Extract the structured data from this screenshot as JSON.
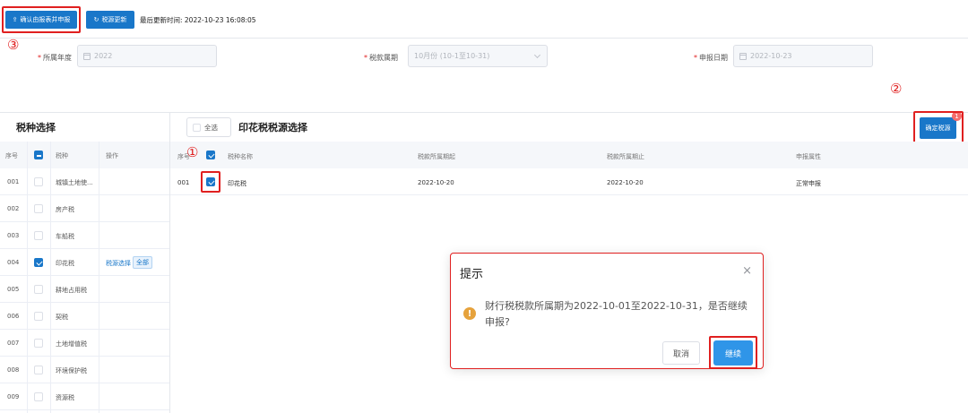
{
  "toolbar": {
    "confirm_label": "确认由报表并申报",
    "refresh_label": "税源更新",
    "last_update_label": "最后更新时间: 2022-10-23 16:08:05"
  },
  "annotations": {
    "step1": "①",
    "step2": "②",
    "step3": "③"
  },
  "form": {
    "year_label": "所属年度",
    "year_value": "2022",
    "period_label": "税款属期",
    "period_value": "10月份 (10-1至10-31)",
    "date_label": "申报日期",
    "date_value": "2022-10-23"
  },
  "left_panel": {
    "title": "税种选择",
    "headers": {
      "no": "序号",
      "name": "税种",
      "op": "操作"
    },
    "rows": [
      {
        "no": "001",
        "name": "城镇土地使...",
        "checked": false
      },
      {
        "no": "002",
        "name": "房产税",
        "checked": false
      },
      {
        "no": "003",
        "name": "车船税",
        "checked": false
      },
      {
        "no": "004",
        "name": "印花税",
        "checked": true,
        "op_link": "税源选择",
        "op_tag": "全部"
      },
      {
        "no": "005",
        "name": "耕地占用税",
        "checked": false
      },
      {
        "no": "006",
        "name": "契税",
        "checked": false
      },
      {
        "no": "007",
        "name": "土地增值税",
        "checked": false
      },
      {
        "no": "008",
        "name": "环境保护税",
        "checked": false
      },
      {
        "no": "009",
        "name": "资源税",
        "checked": false
      }
    ]
  },
  "right_panel": {
    "select_all_label": "全选",
    "title": "印花税税源选择",
    "confirm_button": "确定税源",
    "badge_count": "1",
    "headers": {
      "no": "序号",
      "name": "税种名称",
      "start": "税款所属期起",
      "end": "税款所属期止",
      "attr": "申报属性"
    },
    "rows": [
      {
        "no": "001",
        "checked": true,
        "name": "印花税",
        "start": "2022-10-20",
        "end": "2022-10-20",
        "attr": "正常申报"
      }
    ]
  },
  "dialog": {
    "title": "提示",
    "close": "×",
    "message": "财行税税款所属期为2022-10-01至2022-10-31，是否继续申报?",
    "cancel_label": "取消",
    "continue_label": "继续"
  },
  "colors": {
    "primary": "#1977c9",
    "highlight": "#e02020",
    "warning": "#e6a23c"
  }
}
